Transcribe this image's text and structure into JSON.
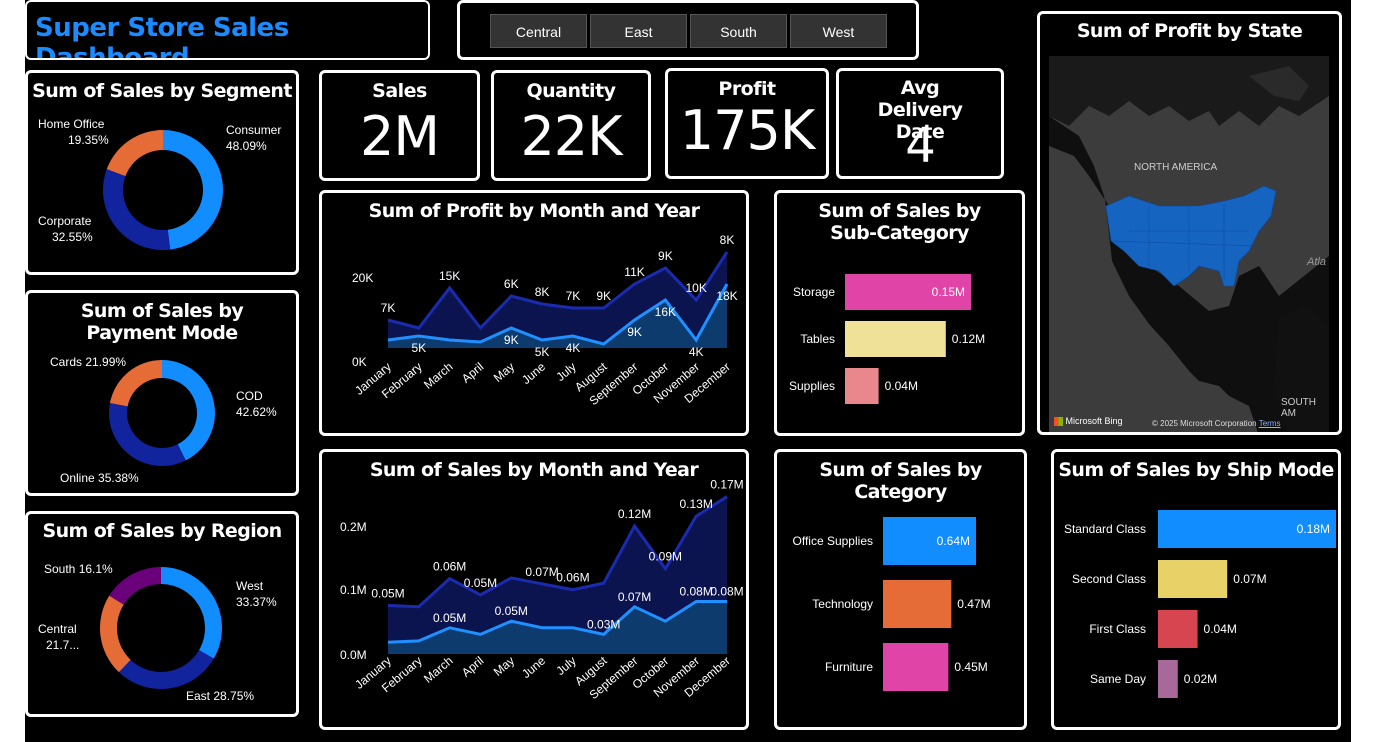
{
  "header": {
    "title": "Super Store Sales Dashboard",
    "title_color": "#1a8cff"
  },
  "slicer": {
    "items": [
      "Central",
      "East",
      "South",
      "West"
    ]
  },
  "kpis": [
    {
      "label": "Sales",
      "value": "2M"
    },
    {
      "label": "Quantity",
      "value": "22K"
    },
    {
      "label": "Profit",
      "value": "175K"
    },
    {
      "label": "Avg Delivery Date",
      "value": "4"
    }
  ],
  "colors": {
    "blue": "#118dff",
    "navy": "#12239e",
    "orange": "#e66c37",
    "purple": "#6b007b",
    "pink": "#e044a7",
    "khaki": "#f0e199",
    "rosepink": "#e8878c",
    "yellow": "#e8d166",
    "red": "#d64550",
    "lavender": "#a66999",
    "dark_area": "#0c1450",
    "light_area": "#0d3b6e"
  },
  "segment": {
    "title": "Sum of Sales by Segment",
    "slices": [
      {
        "name": "Consumer",
        "pct": "48.09%",
        "value": 48.09
      },
      {
        "name": "Corporate",
        "pct": "32.55%",
        "value": 32.55
      },
      {
        "name": "Home Office",
        "pct": "19.35%",
        "value": 19.35
      }
    ]
  },
  "payment": {
    "title": "Sum of Sales by Payment Mode",
    "slices": [
      {
        "name": "COD",
        "pct": "42.62%",
        "value": 42.62
      },
      {
        "name": "Online",
        "pct": "35.38%",
        "value": 35.38
      },
      {
        "name": "Cards",
        "pct": "21.99%",
        "value": 21.99
      }
    ]
  },
  "region": {
    "title": "Sum of Sales by Region",
    "slices": [
      {
        "name": "West",
        "pct": "33.37%",
        "value": 33.37
      },
      {
        "name": "East",
        "pct": "28.75%",
        "value": 28.75
      },
      {
        "name": "Central",
        "pct": "21.7...",
        "value": 21.78
      },
      {
        "name": "South",
        "pct": "16.1%",
        "value": 16.1
      }
    ]
  },
  "profit_month": {
    "title": "Sum of Profit by Month and Year",
    "y_ticks": [
      "20K",
      "0K"
    ],
    "months": [
      "January",
      "February",
      "March",
      "April",
      "May",
      "June",
      "July",
      "August",
      "September",
      "October",
      "November",
      "December"
    ],
    "upper": [
      7,
      5,
      15,
      5,
      13,
      11,
      10,
      10,
      16,
      20,
      12,
      24
    ],
    "lower": [
      2,
      3,
      2,
      1.5,
      5,
      2,
      3,
      1,
      7,
      12,
      2,
      16
    ],
    "upper_labels": [
      "7K",
      "",
      "15K",
      "",
      "6K",
      "8K",
      "7K",
      "9K",
      "11K",
      "9K",
      "10K",
      "8K"
    ],
    "lower_labels": [
      "",
      "5K",
      "",
      "",
      "9K",
      "5K",
      "4K",
      "",
      "9K",
      "16K",
      "4K",
      "18K"
    ]
  },
  "sales_month": {
    "title": "Sum of Sales by Month and Year",
    "y_ticks": [
      "0.2M",
      "0.1M",
      "0.0M"
    ],
    "months": [
      "January",
      "February",
      "March",
      "April",
      "May",
      "June",
      "July",
      "August",
      "September",
      "October",
      "November",
      "December"
    ],
    "upper": [
      0.074,
      0.072,
      0.115,
      0.09,
      0.116,
      0.107,
      0.098,
      0.108,
      0.195,
      0.13,
      0.21,
      0.24
    ],
    "lower": [
      0.018,
      0.02,
      0.04,
      0.03,
      0.05,
      0.04,
      0.04,
      0.03,
      0.072,
      0.05,
      0.08,
      0.08
    ],
    "upper_labels": [
      "0.05M",
      "",
      "0.06M",
      "0.05M",
      "",
      "0.07M",
      "0.06M",
      "",
      "0.12M",
      "0.09M",
      "0.13M",
      "0.17M"
    ],
    "lower_labels": [
      "",
      "",
      "0.05M",
      "",
      "0.05M",
      "",
      "",
      "0.03M",
      "0.07M",
      "",
      "0.08M",
      "0.08M"
    ]
  },
  "subcat": {
    "title": "Sum of Sales by Sub-Category",
    "bars": [
      {
        "name": "Storage",
        "label": "0.15M",
        "value": 0.15
      },
      {
        "name": "Tables",
        "label": "0.12M",
        "value": 0.12
      },
      {
        "name": "Supplies",
        "label": "0.04M",
        "value": 0.04
      }
    ]
  },
  "category": {
    "title": "Sum of Sales by Category",
    "bars": [
      {
        "name": "Office Supplies",
        "label": "0.64M",
        "value": 0.64
      },
      {
        "name": "Technology",
        "label": "0.47M",
        "value": 0.47
      },
      {
        "name": "Furniture",
        "label": "0.45M",
        "value": 0.45
      }
    ]
  },
  "shipmode": {
    "title": "Sum of Sales by Ship Mode",
    "bars": [
      {
        "name": "Standard Class",
        "label": "0.18M",
        "value": 0.18
      },
      {
        "name": "Second Class",
        "label": "0.07M",
        "value": 0.07
      },
      {
        "name": "First Class",
        "label": "0.04M",
        "value": 0.04
      },
      {
        "name": "Same Day",
        "label": "0.02M",
        "value": 0.02
      }
    ]
  },
  "map": {
    "title": "Sum of Profit by State",
    "continent_label": "NORTH AMERICA",
    "ocean_label": "Atla",
    "south_label": "SOUTH AM",
    "bing": "Microsoft Bing",
    "copyright": "© 2025 Microsoft Corporation",
    "terms": "Terms"
  }
}
